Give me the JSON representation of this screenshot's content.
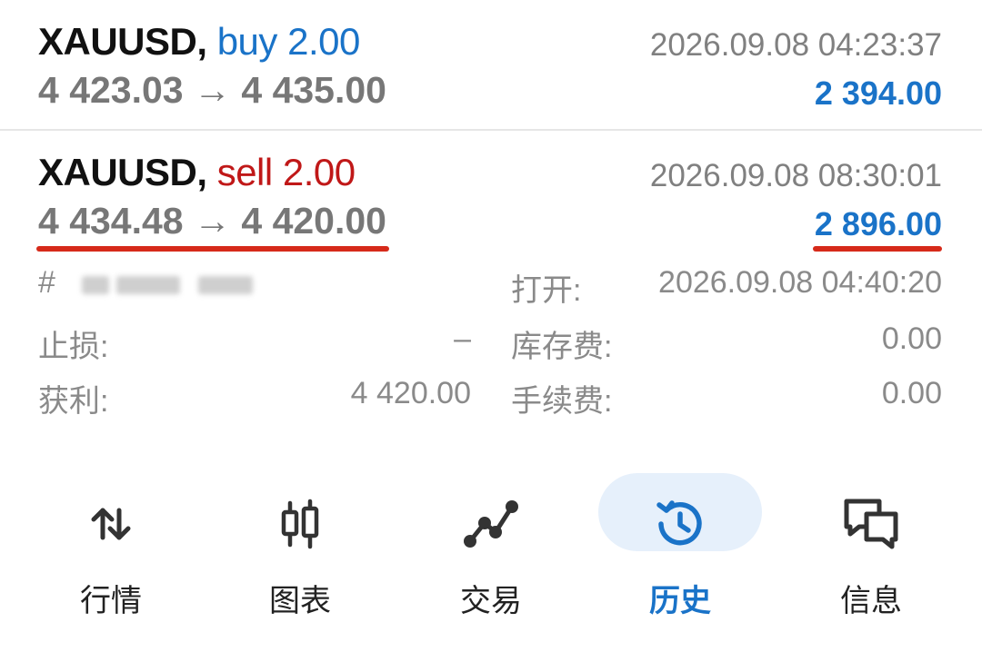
{
  "trades": [
    {
      "symbol": "XAUUSD,",
      "direction": "buy 2.00",
      "prices": "4 423.03 → 4 435.00",
      "time": "2026.09.08 04:23:37",
      "profit": "2 394.00"
    },
    {
      "symbol": "XAUUSD,",
      "direction": "sell 2.00",
      "prices": "4 434.48 → 4 420.00",
      "time": "2026.09.08 08:30:01",
      "profit": "2 896.00",
      "details": {
        "ticket_prefix": "#",
        "open_label": "打开:",
        "open_time": "2026.09.08 04:40:20",
        "sl_label": "止损:",
        "sl_value": "–",
        "swap_label": "库存费:",
        "swap_value": "0.00",
        "tp_label": "获利:",
        "tp_value": "4 420.00",
        "commission_label": "手续费:",
        "commission_value": "0.00"
      }
    }
  ],
  "nav": {
    "quotes": "行情",
    "chart": "图表",
    "trade": "交易",
    "history": "历史",
    "messages": "信息",
    "active": "history"
  },
  "colors": {
    "buy": "#1a73c8",
    "sell": "#c01818",
    "profit": "#1a73c8",
    "highlight_underline": "#d62a1a",
    "active_pill": "#e6f0fb"
  },
  "icons": {
    "quotes": "up-down-arrows-icon",
    "chart": "candlestick-icon",
    "trade": "line-chart-icon",
    "history": "history-clock-icon",
    "messages": "chat-bubbles-icon"
  }
}
